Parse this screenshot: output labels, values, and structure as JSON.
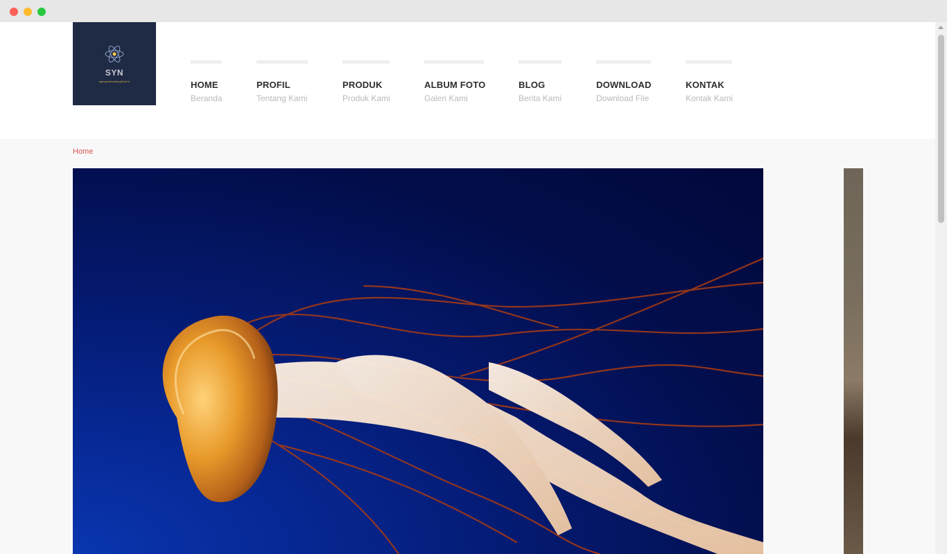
{
  "window": {
    "controls": [
      "close",
      "minimize",
      "maximize"
    ]
  },
  "logo": {
    "name": "SYN",
    "subtitle": "agungmartowisy.github.io",
    "icon": "atom-icon"
  },
  "nav": {
    "items": [
      {
        "title": "HOME",
        "subtitle": "Beranda"
      },
      {
        "title": "PROFIL",
        "subtitle": "Tentang Kami"
      },
      {
        "title": "PRODUK",
        "subtitle": "Produk Kami"
      },
      {
        "title": "ALBUM FOTO",
        "subtitle": "Galeri Kami"
      },
      {
        "title": "BLOG",
        "subtitle": "Berita Kami"
      },
      {
        "title": "DOWNLOAD",
        "subtitle": "Download File"
      },
      {
        "title": "KONTAK",
        "subtitle": "Kontak Kami"
      }
    ]
  },
  "breadcrumb": {
    "home": "Home"
  },
  "slider": {
    "current_slide": "jellyfish-photo",
    "next_slide": "photo-partial"
  },
  "colors": {
    "accent": "#d9534f",
    "logo_bg": "#1f2a44",
    "nav_text": "#2d2d2d",
    "nav_sub": "#b9b9b9"
  }
}
